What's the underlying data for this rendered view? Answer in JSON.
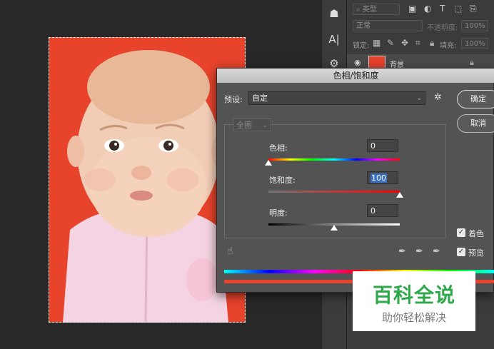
{
  "dialog": {
    "title": "色相/饱和度",
    "preset_label": "预设:",
    "preset_value": "自定",
    "channel": "全图",
    "hue_label": "色相:",
    "hue_value": "0",
    "saturation_label": "饱和度:",
    "saturation_value": "100",
    "lightness_label": "明度:",
    "lightness_value": "0",
    "ok_label": "确定",
    "cancel_label": "取消",
    "colorize_label": "着色",
    "preview_label": "预览",
    "slider_levels": {
      "hue": 0,
      "saturation": 100,
      "lightness": 0
    }
  },
  "layers": {
    "filter_label": "类型",
    "blend_mode": "正常",
    "opacity_label": "不透明度:",
    "opacity_value": "100%",
    "lock_label": "锁定:",
    "fill_label": "填充:",
    "fill_value": "100%",
    "layer_name": "背景"
  },
  "watermark": {
    "title": "百科全说",
    "subtitle": "助你轻松解决"
  },
  "colors": {
    "background_fill": "#e8432b",
    "dialog_bg": "#535353",
    "panel_bg": "#3b3b3b"
  }
}
